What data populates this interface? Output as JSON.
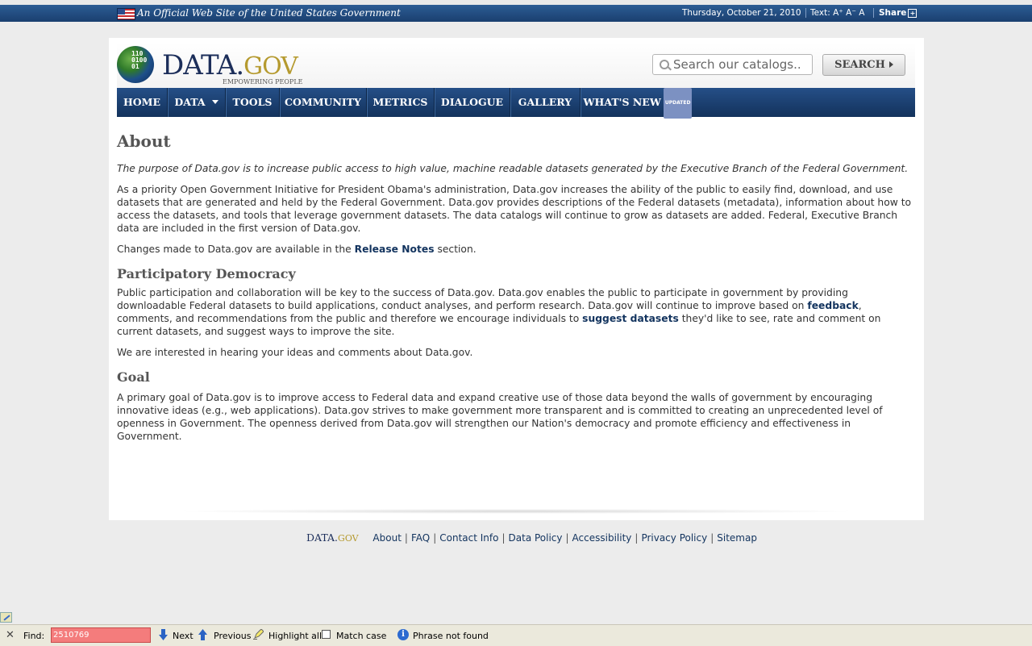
{
  "govbar": {
    "official": "An Official Web Site of the United States Government",
    "date": "Thursday, October 21, 2010",
    "text_size_label": "Text: A⁺ A⁻ A",
    "share": "Share"
  },
  "header": {
    "logo_main": "DATA.",
    "logo_gov": "GOV",
    "logo_binary": "110\n0100\n01",
    "tagline": "EMPOWERING PEOPLE",
    "search_placeholder": "Search our catalogs..",
    "search_button": "SEARCH"
  },
  "nav": {
    "items": [
      {
        "label": "HOME"
      },
      {
        "label": "DATA"
      },
      {
        "label": "TOOLS"
      },
      {
        "label": "COMMUNITY"
      },
      {
        "label": "METRICS"
      },
      {
        "label": "DIALOGUE"
      },
      {
        "label": "GALLERY"
      },
      {
        "label": "WHAT'S NEW"
      }
    ],
    "badge": "UPDATED"
  },
  "content": {
    "about_heading": "About",
    "intro": "The purpose of Data.gov is to increase public access to high value, machine readable datasets generated by the Executive Branch of the Federal Government.",
    "about_p1": "As a priority Open Government Initiative for President Obama's administration, Data.gov increases the ability of the public to easily find, download, and use datasets that are generated and held by the Federal Government. Data.gov provides descriptions of the Federal datasets (metadata), information about how to access the datasets, and tools that leverage government datasets. The data catalogs will continue to grow as datasets are added. Federal, Executive Branch data are included in the first version of Data.gov.",
    "about_p2_pre": "Changes made to Data.gov are available in the ",
    "release_notes_link": "Release Notes",
    "about_p2_post": " section.",
    "participatory_heading": "Participatory Democracy",
    "part_p1_a": "Public participation and collaboration will be key to the success of Data.gov. Data.gov enables the public to participate in government by providing downloadable Federal datasets to build applications, conduct analyses, and perform research. Data.gov will continue to improve based on ",
    "feedback_link": "feedback",
    "part_p1_b": ", comments, and recommendations from the public and therefore we encourage individuals to ",
    "suggest_link": "suggest datasets",
    "part_p1_c": " they'd like to see, rate and comment on current datasets, and suggest ways to improve the site.",
    "part_p2": "We are interested in hearing your ideas and comments about Data.gov.",
    "goal_heading": "Goal",
    "goal_p1": "A primary goal of Data.gov is to improve access to Federal data and expand creative use of those data beyond the walls of government by encouraging innovative ideas (e.g., web applications). Data.gov strives to make government more transparent and is committed to creating an unprecedented level of openness in Government. The openness derived from Data.gov will strengthen our Nation's democracy and promote efficiency and effectiveness in Government."
  },
  "footer": {
    "logo_main": "DATA.",
    "logo_gov": "GOV",
    "links": [
      "About",
      "FAQ",
      "Contact Info",
      "Data Policy",
      "Accessibility",
      "Privacy Policy",
      "Sitemap"
    ]
  },
  "findbar": {
    "label": "Find:",
    "value": "2510769",
    "next": "Next",
    "previous": "Previous",
    "highlight_all": "Highlight all",
    "match_case": "Match case",
    "status": "Phrase not found"
  },
  "colors": {
    "nav_bg": "#1a3f6f",
    "link": "#12335e",
    "logo_gold": "#b59a2f",
    "find_not_found": "#f47c7c"
  }
}
